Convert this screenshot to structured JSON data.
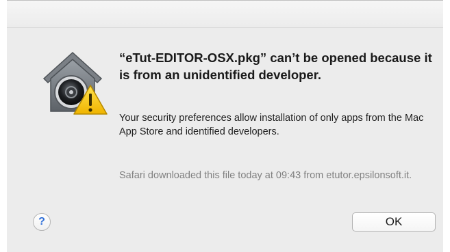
{
  "dialog": {
    "title": "“eTut-EDITOR-OSX.pkg” can’t be opened because it is from an unidentified developer.",
    "message": "Your security preferences allow installation of only apps from the Mac App Store and identified developers.",
    "source": "Safari downloaded this file today at 09:43 from etutor.epsilonsoft.it.",
    "help_label": "?",
    "ok_label": "OK",
    "icon": "gatekeeper-warning-icon"
  },
  "colors": {
    "dialog_background": "#ececec",
    "help_accent": "#2f6fd8",
    "warning_yellow": "#f3c316"
  }
}
